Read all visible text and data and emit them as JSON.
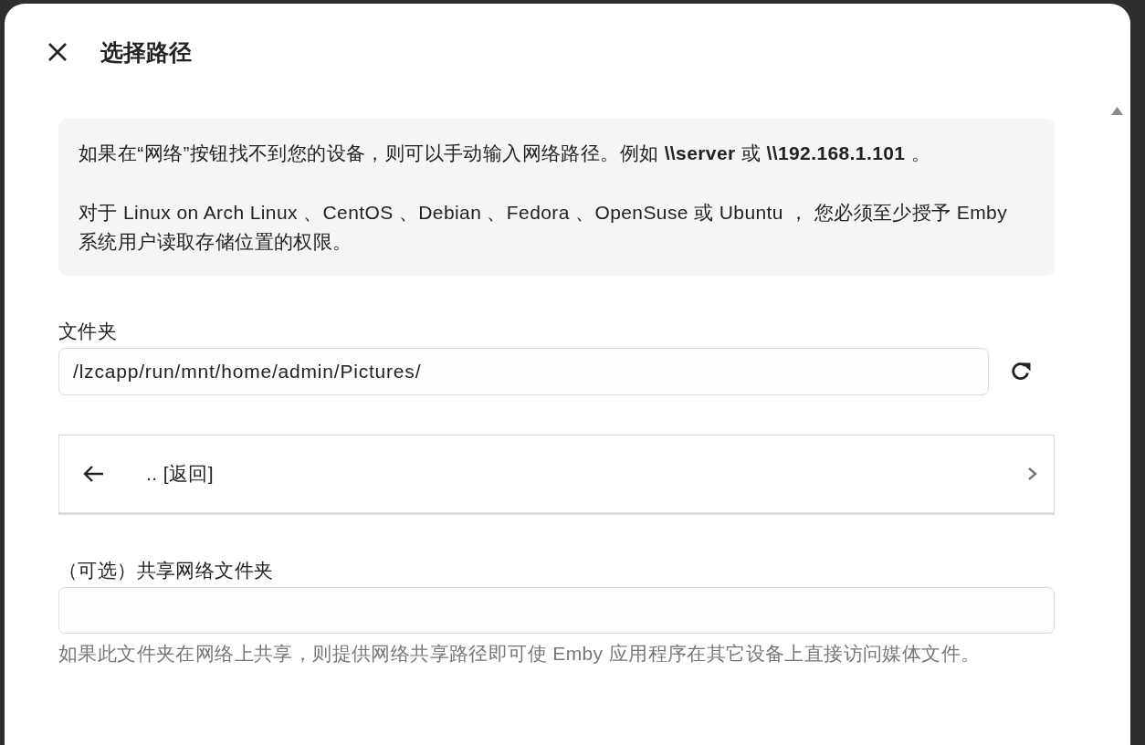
{
  "dialog": {
    "title": "选择路径"
  },
  "info": {
    "paragraphs": [
      "如果在“网络”按钮找不到您的设备，则可以手动输入网络路径。例如 **\\\\server** 或 **\\\\192.168.1.101** 。",
      "对于 Linux on Arch Linux 、CentOS 、Debian 、Fedora 、OpenSuse 或 Ubuntu ， 您必须至少授予 Emby 系统用户读取存储位置的权限。"
    ]
  },
  "folder": {
    "label": "文件夹",
    "value": "/lzcapp/run/mnt/home/admin/Pictures/"
  },
  "entries": [
    {
      "kind": "parent",
      "label": ".. [返回]"
    }
  ],
  "network_share": {
    "label": "（可选）共享网络文件夹",
    "help": "如果此文件夹在网络上共享，则提供网络共享路径即可使 Emby 应用程序在其它设备上直接访问媒体文件。"
  }
}
